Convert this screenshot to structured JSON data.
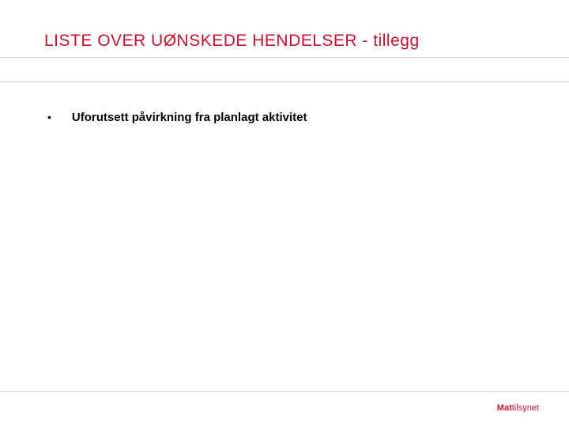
{
  "title": "LISTE OVER UØNSKEDE HENDELSER -  tillegg",
  "bullets": [
    {
      "marker": "•",
      "text": "Uforutsett påvirkning fra planlagt aktivitet"
    }
  ],
  "footer": {
    "brand_bold": "Mat",
    "brand_light": "tilsynet"
  },
  "colors": {
    "accent": "#c8102e"
  }
}
